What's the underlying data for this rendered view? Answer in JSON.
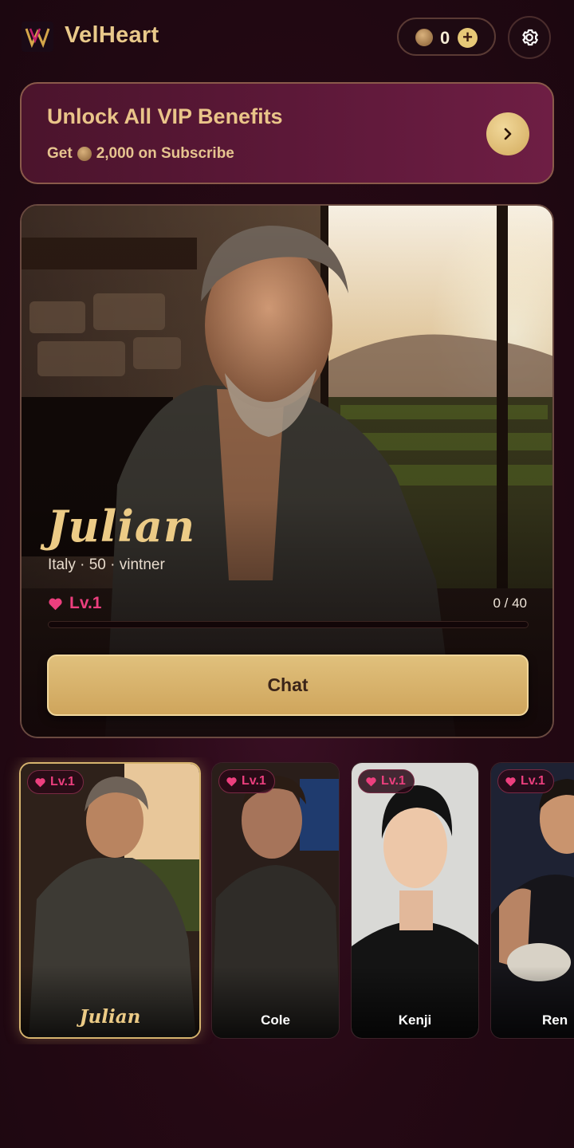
{
  "header": {
    "app_title": "VelHeart",
    "coins": "0",
    "plus": "+"
  },
  "vip_banner": {
    "title": "Unlock All VIP Benefits",
    "sub_prefix": "Get",
    "sub_amount": "2,000 on Subscribe"
  },
  "hero": {
    "name": "Julian",
    "meta": "Italy · 50 · vintner",
    "level": "Lv.1",
    "progress_text": "0 / 40",
    "progress_fraction": 0,
    "chat_label": "Chat"
  },
  "characters": [
    {
      "name": "Julian",
      "level": "Lv.1",
      "selected": true
    },
    {
      "name": "Cole",
      "level": "Lv.1",
      "selected": false
    },
    {
      "name": "Kenji",
      "level": "Lv.1",
      "selected": false
    },
    {
      "name": "Ren",
      "level": "Lv.1",
      "selected": false
    }
  ],
  "colors": {
    "accent_gold": "#e0c07c",
    "level_pink": "#ec3f7e",
    "background": "#250914"
  },
  "icons": [
    "logo-icon",
    "coin-icon",
    "plus-icon",
    "gear-icon",
    "chevron-right-icon",
    "heart-icon"
  ]
}
